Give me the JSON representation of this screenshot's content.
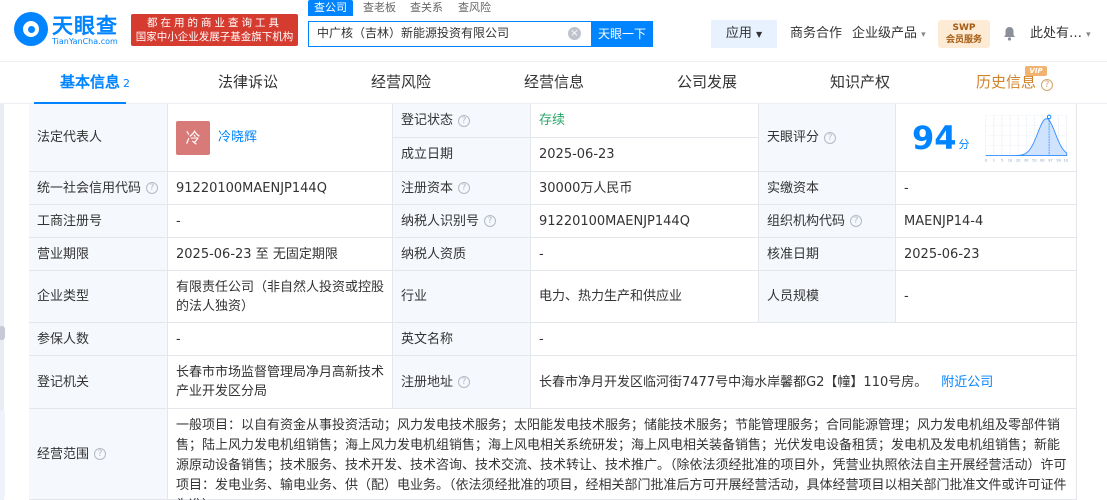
{
  "brand": {
    "name": "天眼查",
    "domain": "TianYanCha.com",
    "slogan_line1": "都在用的商业查询工具",
    "slogan_line2": "国家中小企业发展子基金旗下机构"
  },
  "search": {
    "tabs": [
      "查公司",
      "查老板",
      "查关系",
      "查风险"
    ],
    "active_tab": 0,
    "value": "中广核（吉林）新能源投资有限公司",
    "button_label": "天眼一下"
  },
  "topnav": {
    "app": "应用",
    "business": "商务合作",
    "enterprise": "企业级产品",
    "swp_line1": "SWP",
    "swp_line2": "会员服务",
    "user": "此处有…"
  },
  "tabs": {
    "basic": "基本信息",
    "basic_count": "2",
    "legal": "法律诉讼",
    "risk": "经营风险",
    "ops": "经营信息",
    "dev": "公司发展",
    "ip": "知识产权",
    "history": "历史信息",
    "vip": "VIP"
  },
  "info": {
    "legal_rep_label": "法定代表人",
    "legal_rep_avatar": "冷",
    "legal_rep_name": "冷晓辉",
    "reg_status_label": "登记状态",
    "reg_status": "存续",
    "est_date_label": "成立日期",
    "est_date": "2025-06-23",
    "score_label": "天眼评分",
    "score": "94",
    "score_unit": "分",
    "credit_code_label": "统一社会信用代码",
    "credit_code": "91220100MAENJP144Q",
    "reg_capital_label": "注册资本",
    "reg_capital": "30000万人民币",
    "paid_capital_label": "实缴资本",
    "paid_capital": "-",
    "biz_reg_no_label": "工商注册号",
    "biz_reg_no": "-",
    "taxpayer_id_label": "纳税人识别号",
    "taxpayer_id": "91220100MAENJP144Q",
    "org_code_label": "组织机构代码",
    "org_code": "MAENJP14-4",
    "term_label": "营业期限",
    "term": "2025-06-23 至 无固定期限",
    "taxpayer_qual_label": "纳税人资质",
    "taxpayer_qual": "-",
    "approval_date_label": "核准日期",
    "approval_date": "2025-06-23",
    "company_type_label": "企业类型",
    "company_type": "有限责任公司（非自然人投资或控股的法人独资）",
    "industry_label": "行业",
    "industry": "电力、热力生产和供应业",
    "staff_size_label": "人员规模",
    "staff_size": "-",
    "insured_label": "参保人数",
    "insured": "-",
    "english_name_label": "英文名称",
    "english_name": "-",
    "reg_authority_label": "登记机关",
    "reg_authority": "长春市市场监督管理局净月高新技术产业开发区分局",
    "reg_address_label": "注册地址",
    "reg_address": "长春市净月开发区临河街7477号中海水岸馨都G2【幢】110号房。",
    "nearby_link": "附近公司",
    "scope_label": "经营范围",
    "scope": "一般项目：以自有资金从事投资活动；风力发电技术服务；太阳能发电技术服务；储能技术服务；节能管理服务；合同能源管理；风力发电机组及零部件销售；陆上风力发电机组销售；海上风力发电机组销售；海上风电相关系统研发；海上风电相关装备销售；光伏发电设备租赁；发电机及发电机组销售；新能源原动设备销售；技术服务、技术开发、技术咨询、技术交流、技术转让、技术推广。（除依法须经批准的项目外，凭营业执照依法自主开展经营活动）许可项目：发电业务、输电业务、供（配）电业务。（依法须经批准的项目，经相关部门批准后方可开展经营活动，具体经营项目以相关部门批准文件或许可证件为准）"
  },
  "score_chart": {
    "ticks": [
      "0",
      "1",
      "5",
      "10",
      "20",
      "30",
      "50",
      "80",
      "97",
      "99",
      "100"
    ],
    "marker": 94
  },
  "colors": {
    "accent": "#0084ff",
    "slogan_bg": "#d63b2f",
    "status_green": "#2aa56a",
    "history_gold": "#d1832a"
  }
}
